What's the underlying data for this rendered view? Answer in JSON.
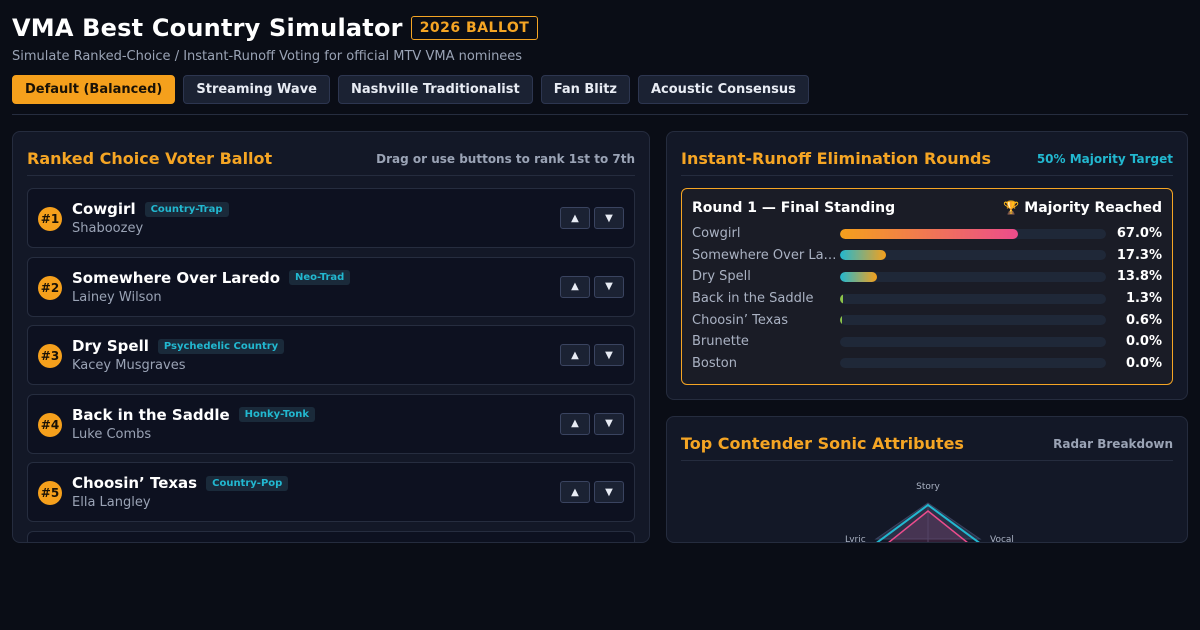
{
  "header": {
    "title": "VMA Best Country Simulator",
    "badge": "2026 BALLOT",
    "subtitle": "Simulate Ranked-Choice / Instant-Runoff Voting for official MTV VMA nominees"
  },
  "presets": [
    {
      "label": "Default (Balanced)",
      "active": true
    },
    {
      "label": "Streaming Wave",
      "active": false
    },
    {
      "label": "Nashville Traditionalist",
      "active": false
    },
    {
      "label": "Fan Blitz",
      "active": false
    },
    {
      "label": "Acoustic Consensus",
      "active": false
    }
  ],
  "ballot": {
    "title": "Ranked Choice Voter Ballot",
    "hint": "Drag or use buttons to rank 1st to 7th",
    "up_icon": "▲",
    "down_icon": "▼",
    "items": [
      {
        "rank": "#1",
        "title": "Cowgirl",
        "genre": "Country-Trap",
        "artist": "Shaboozey"
      },
      {
        "rank": "#2",
        "title": "Somewhere Over Laredo",
        "genre": "Neo-Trad",
        "artist": "Lainey Wilson"
      },
      {
        "rank": "#3",
        "title": "Dry Spell",
        "genre": "Psychedelic Country",
        "artist": "Kacey Musgraves"
      },
      {
        "rank": "#4",
        "title": "Back in the Saddle",
        "genre": "Honky-Tonk",
        "artist": "Luke Combs"
      },
      {
        "rank": "#5",
        "title": "Choosin’ Texas",
        "genre": "Country-Pop",
        "artist": "Ella Langley"
      }
    ]
  },
  "rounds": {
    "title": "Instant-Runoff Elimination Rounds",
    "target": "50% Majority Target",
    "round_title": "Round 1 — Final Standing",
    "status": "Majority Reached",
    "trophy_icon": "🏆",
    "rows": [
      {
        "name": "Cowgirl",
        "pct": 67.0,
        "label": "67.0%",
        "style": "win"
      },
      {
        "name": "Somewhere Over Laredo",
        "pct": 17.3,
        "label": "17.3%",
        "style": "norm"
      },
      {
        "name": "Dry Spell",
        "pct": 13.8,
        "label": "13.8%",
        "style": "norm"
      },
      {
        "name": "Back in the Saddle",
        "pct": 1.3,
        "label": "1.3%",
        "style": "low"
      },
      {
        "name": "Choosin’ Texas",
        "pct": 0.6,
        "label": "0.6%",
        "style": "low"
      },
      {
        "name": "Brunette",
        "pct": 0.0,
        "label": "0.0%",
        "style": "low"
      },
      {
        "name": "Boston",
        "pct": 0.0,
        "label": "0.0%",
        "style": "low"
      }
    ]
  },
  "radar": {
    "title": "Top Contender Sonic Attributes",
    "hint": "Radar Breakdown",
    "axes": [
      "Story",
      "Vocal",
      "Lyric"
    ]
  },
  "colors": {
    "accent": "#f5a524",
    "cyan": "#22b8d0",
    "pink": "#ec4c8c"
  }
}
